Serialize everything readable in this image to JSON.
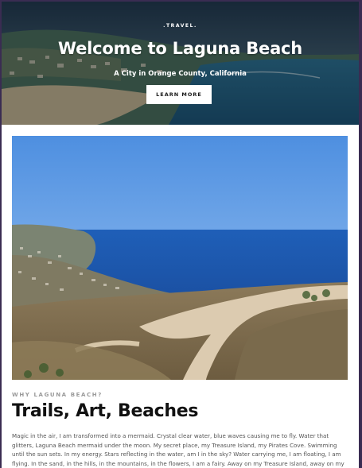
{
  "hero": {
    "kicker": ".TRAVEL.",
    "title": "Welcome to Laguna Beach",
    "subtitle": "A City in Orange County, California",
    "button_label": "LEARN MORE"
  },
  "photo": {
    "alt": "Coastal hillside trail overlooking Laguna Beach"
  },
  "section": {
    "eyebrow": "WHY LAGUNA BEACH?",
    "title": "Trails, Art, Beaches",
    "body": "Magic in the air, I am transformed into a mermaid. Crystal clear water, blue waves causing me to fly. Water that glitters, Laguna Beach mermaid under the moon. My secret place, my Treasure Island, my Pirates Cove. Swimming until the sun sets. In my energy. Stars reflecting in the water, am I in the sky? Water carrying me, I am floating, I am flying. In the sand, in the hills, in the mountains, in the flowers, I am a fairy. Away on my Treasure Island, away on my"
  }
}
